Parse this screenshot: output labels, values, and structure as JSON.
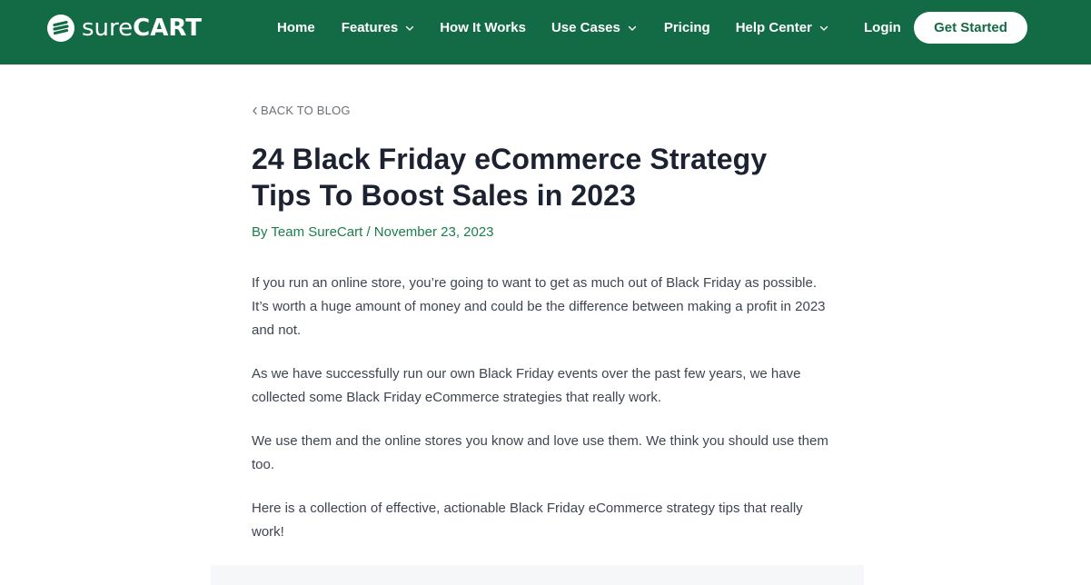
{
  "brand": {
    "name_light": "sure",
    "name_bold": "CART",
    "accent_color": "#136b45"
  },
  "nav": {
    "items": [
      {
        "label": "Home",
        "has_dropdown": false
      },
      {
        "label": "Features",
        "has_dropdown": true
      },
      {
        "label": "How It Works",
        "has_dropdown": false
      },
      {
        "label": "Use Cases",
        "has_dropdown": true
      },
      {
        "label": "Pricing",
        "has_dropdown": false
      },
      {
        "label": "Help Center",
        "has_dropdown": true
      }
    ],
    "login_label": "Login",
    "cta_label": "Get Started"
  },
  "article": {
    "back_label": "BACK TO BLOG",
    "title": "24 Black Friday eCommerce Strategy Tips To Boost Sales in 2023",
    "meta": "By Team SureCart / November 23, 2023",
    "paragraphs": [
      "If you run an online store, you’re going to want to get as much out of Black Friday as possible. It’s worth a huge amount of money and could be the difference between making a profit in 2023 and not.",
      "As we have successfully run our own Black Friday events over the past few years, we have collected some Black Friday eCommerce strategies that really work.",
      "We use them and the online stores you know and love use them. We think you should use them too.",
      "Here is a collection of effective, actionable Black Friday eCommerce strategy tips that really work!"
    ]
  },
  "icons": {
    "logo": "surecart-logo-icon",
    "dropdown": "chevron-down-icon",
    "back": "chevron-left-icon"
  }
}
